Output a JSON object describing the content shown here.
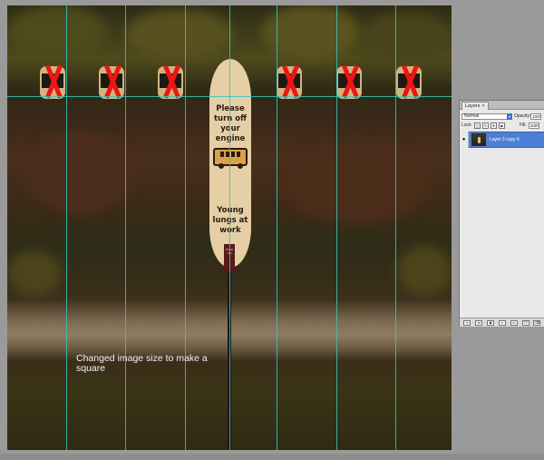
{
  "document": {
    "sign": {
      "top_text": "Please turn off your engine",
      "bottom_text": "Young lungs at work",
      "plaque_text": "Thank You"
    },
    "caption": "Changed image size to make a square"
  },
  "layers_panel": {
    "tab_label": "Layers",
    "tab_close": "×",
    "blend_mode": "Normal",
    "opacity_label": "Opacity:",
    "opacity_value": "100%",
    "lock_label": "Lock:",
    "fill_label": "Fill:",
    "fill_value": "100%",
    "layer_name": "Layer 3 copy 5",
    "eye_icon": "●",
    "bottom_fx": "fx"
  },
  "icons": {
    "eye": "eye-icon",
    "link": "link-icon",
    "fx": "fx-icon",
    "mask": "mask-icon",
    "adjustment": "adjustment-layer-icon",
    "group": "folder-icon",
    "new_layer": "new-layer-icon",
    "trash": "trash-icon"
  },
  "colors": {
    "guide": "#2ec9c0",
    "selected_layer": "#4c7fd6",
    "x_mark": "#ee1515"
  }
}
